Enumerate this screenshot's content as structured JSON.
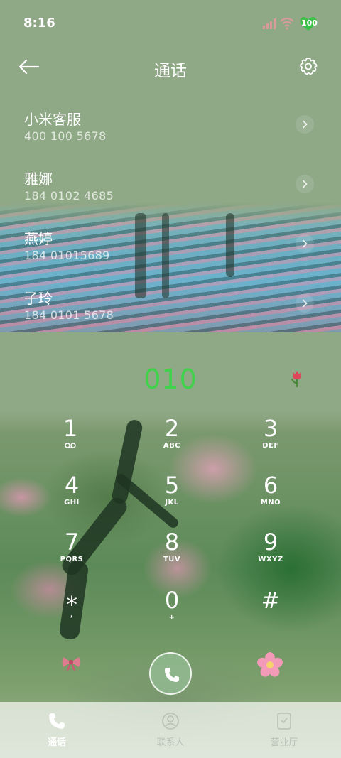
{
  "status_bar": {
    "time": "8:16",
    "battery": "100"
  },
  "header": {
    "title": "通话"
  },
  "recent_calls": [
    {
      "name": "小米客服",
      "number": "400 100 5678"
    },
    {
      "name": "雅娜",
      "number": "184 0102 4685"
    },
    {
      "name": "燕婷",
      "number": "184 01015689"
    },
    {
      "name": "子玲",
      "number": "184 0101 5678"
    }
  ],
  "dialer": {
    "input": "010",
    "accent_color": "#3fd24a",
    "keys": [
      {
        "digit": "1",
        "letters": ""
      },
      {
        "digit": "2",
        "letters": "ABC"
      },
      {
        "digit": "3",
        "letters": "DEF"
      },
      {
        "digit": "4",
        "letters": "GHI"
      },
      {
        "digit": "5",
        "letters": "JKL"
      },
      {
        "digit": "6",
        "letters": "MNO"
      },
      {
        "digit": "7",
        "letters": "PQRS"
      },
      {
        "digit": "8",
        "letters": "TUV"
      },
      {
        "digit": "9",
        "letters": "WXYZ"
      },
      {
        "digit": "*",
        "letters": ","
      },
      {
        "digit": "0",
        "letters": "+"
      },
      {
        "digit": "#",
        "letters": ""
      }
    ]
  },
  "bottom_nav": [
    {
      "label": "通话",
      "icon": "phone-icon",
      "active": true
    },
    {
      "label": "联系人",
      "icon": "contacts-icon",
      "active": false
    },
    {
      "label": "营业厅",
      "icon": "service-hall-icon",
      "active": false
    }
  ]
}
